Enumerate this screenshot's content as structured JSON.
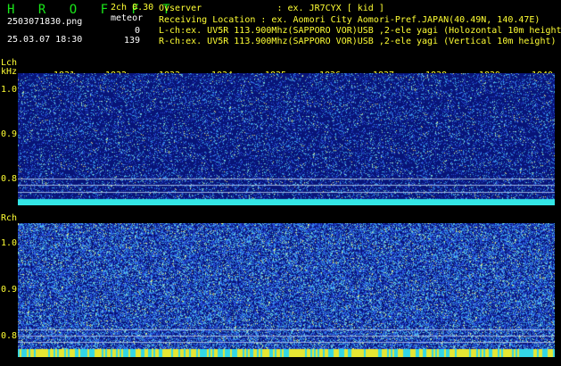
{
  "header": {
    "app_name": "H R O F F T",
    "file_name": "2503071830.png",
    "datetime": "25.03.07 18:30",
    "mode": "2ch 0.30",
    "meteor_label": "meteor",
    "meteor_count_l": "0",
    "meteor_count_r": "139"
  },
  "info": {
    "observer": "Ovserver              : ex. JR7CYX [ kid ]",
    "location": "Receiving Location : ex. Aomori City Aomori-Pref.JAPAN(40.49N, 140.47E)",
    "lch": "L-ch:ex. UV5R 113.900Mhz(SAPPORO VOR)USB ,2-ele yagi (Holozontal 10m height)",
    "rch": "R-ch:ex. UV5R 113.900Mhz(SAPPORO VOR)USB ,2-ele yagi (Vertical 10m height)"
  },
  "lch_panel": {
    "label": "Lch",
    "unit": "kHz",
    "y_ticks": [
      "1.0",
      "0.9",
      "0.8"
    ],
    "x_ticks": [
      "1831",
      "1832",
      "1833",
      "1834",
      "1835",
      "1836",
      "1837",
      "1838",
      "1839",
      "1840"
    ]
  },
  "rch_panel": {
    "label": "Rch",
    "y_ticks": [
      "1.0",
      "0.9",
      "0.8"
    ]
  },
  "colors": {
    "background": "#000000",
    "label": "#ffff33",
    "app_name": "#19e619",
    "spectrogram_base": "#0a1a8c",
    "noise_band": "#33e6e6"
  }
}
